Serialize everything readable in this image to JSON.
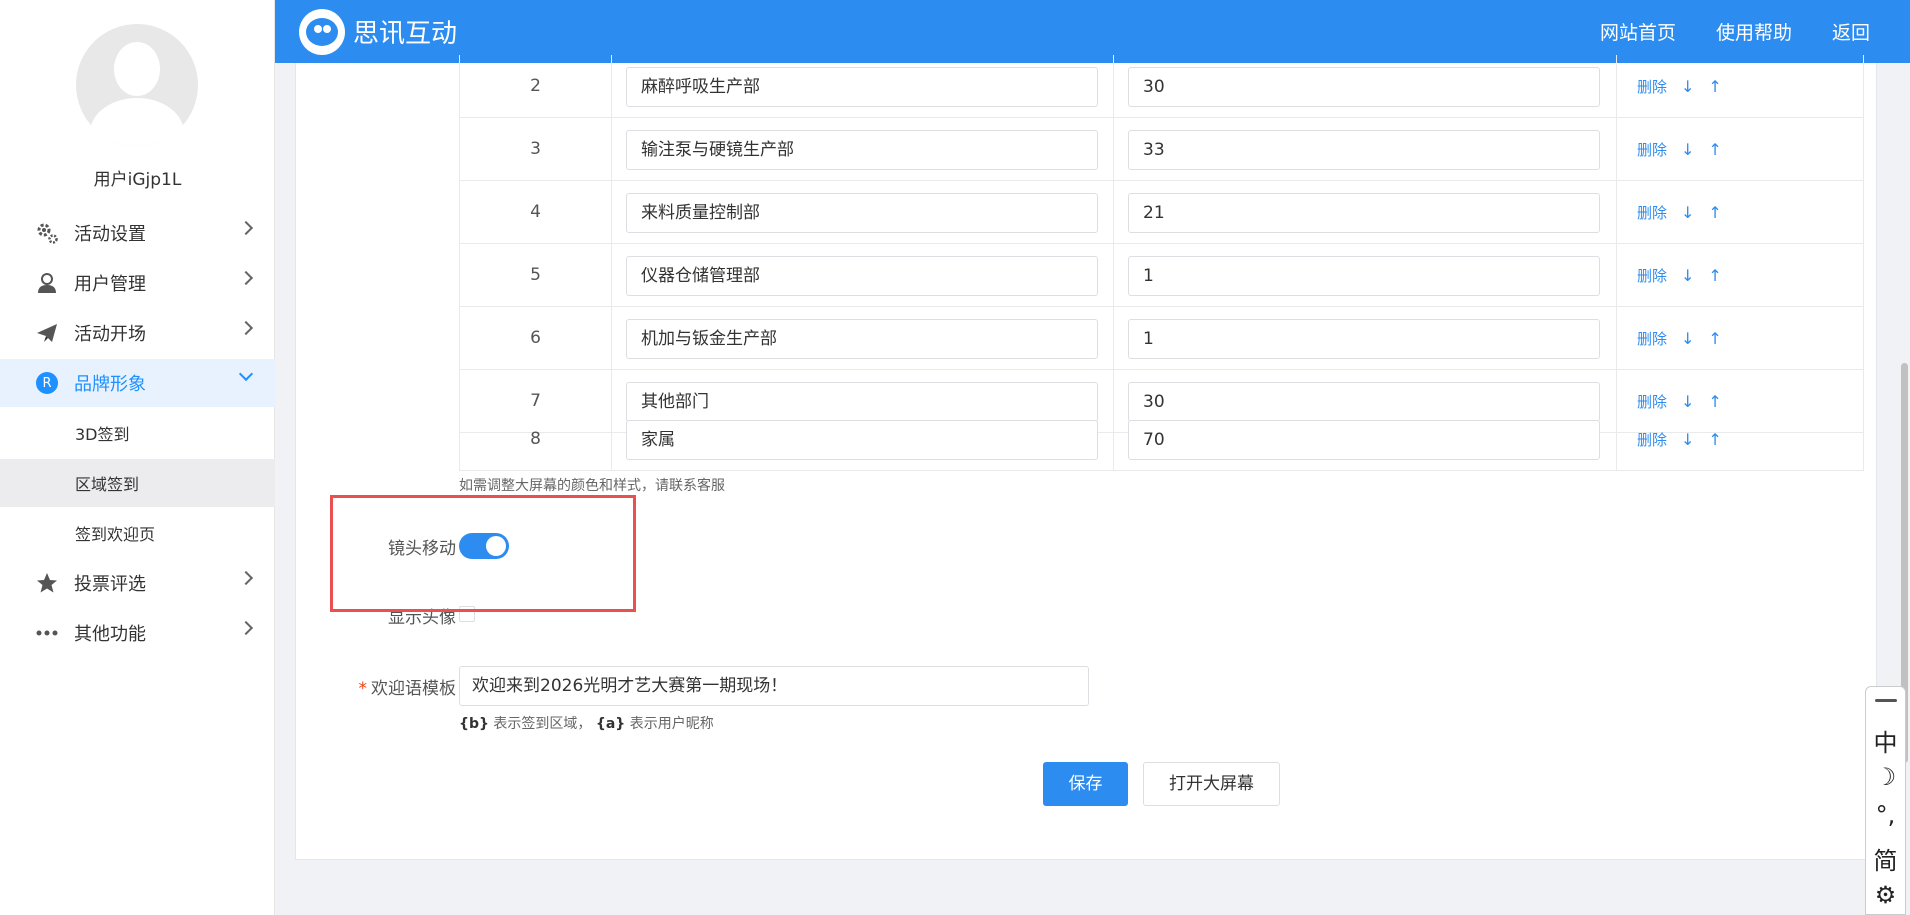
{
  "sidebar": {
    "username": "用户iGjp1L",
    "menu": [
      {
        "label": "活动设置",
        "icon": "gear-icon"
      },
      {
        "label": "用户管理",
        "icon": "user-icon"
      },
      {
        "label": "活动开场",
        "icon": "paper-plane-icon"
      },
      {
        "label": "品牌形象",
        "icon": "r-badge-icon",
        "badge": "R"
      },
      {
        "label": "投票评选",
        "icon": "star-icon"
      },
      {
        "label": "其他功能",
        "icon": "more-dots-icon"
      }
    ],
    "submenu": [
      "3D签到",
      "区域签到",
      "签到欢迎页"
    ]
  },
  "header": {
    "brand": "思讯互动",
    "links": [
      "网站首页",
      "使用帮助",
      "返回"
    ]
  },
  "table": {
    "delete_label": "删除",
    "down_arrow": "↓",
    "up_arrow": "↑",
    "rows": [
      {
        "index": "2",
        "name": "麻醉呼吸生产部",
        "count": "30"
      },
      {
        "index": "3",
        "name": "输注泵与硬镜生产部",
        "count": "33"
      },
      {
        "index": "4",
        "name": "来料质量控制部",
        "count": "21"
      },
      {
        "index": "5",
        "name": "仪器仓储管理部",
        "count": "1"
      },
      {
        "index": "6",
        "name": "机加与钣金生产部",
        "count": "1"
      },
      {
        "index": "7",
        "name": "其他部门",
        "count": "30"
      },
      {
        "index": "8",
        "name": "家属",
        "count": "70"
      }
    ]
  },
  "form": {
    "hint": "如需调整大屏幕的颜色和样式，请联系客服",
    "camera_move_label": "镜头移动",
    "camera_move_on": true,
    "show_avatar_label": "显示头像",
    "show_avatar_checked": false,
    "required_mark": "*",
    "greeting_label": "欢迎语模板",
    "greeting_value": "欢迎来到2026光明才艺大赛第一期现场！",
    "greeting_hint_b": "{b}",
    "greeting_hint_b_text": " 表示签到区域，",
    "greeting_hint_a": "{a}",
    "greeting_hint_a_text": " 表示用户昵称",
    "save_label": "保存",
    "open_screen_label": "打开大屏幕"
  },
  "ime": {
    "keys": [
      "中",
      "☽",
      "°,",
      "简",
      "⚙"
    ]
  },
  "colors": {
    "primary": "#2d8cf0",
    "highlight_border": "#e9504f"
  }
}
